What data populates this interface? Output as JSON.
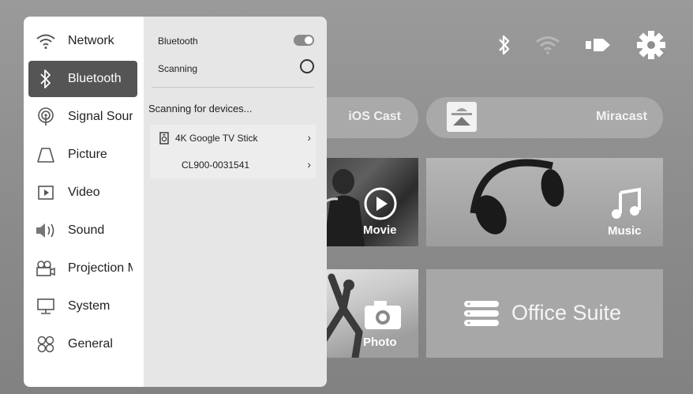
{
  "menu": {
    "items": [
      {
        "label": "Network",
        "icon": "wifi-icon"
      },
      {
        "label": "Bluetooth",
        "icon": "bluetooth-icon",
        "active": true
      },
      {
        "label": "Signal Source",
        "icon": "signal-source-icon"
      },
      {
        "label": "Picture",
        "icon": "picture-icon"
      },
      {
        "label": "Video",
        "icon": "video-icon"
      },
      {
        "label": "Sound",
        "icon": "speaker-icon"
      },
      {
        "label": "Projection Mode",
        "icon": "projector-icon"
      },
      {
        "label": "System",
        "icon": "monitor-icon"
      },
      {
        "label": "General",
        "icon": "general-icon"
      }
    ]
  },
  "panel": {
    "bluetooth_label": "Bluetooth",
    "bluetooth_on": true,
    "scanning_label": "Scanning",
    "scan_title": "Scanning for devices...",
    "devices": [
      {
        "name": "4K Google TV Stick",
        "icon": "speaker-device-icon",
        "chevron": "›"
      },
      {
        "name": "CL900-0031541",
        "chevron": "›"
      }
    ]
  },
  "tiles": {
    "ios_cast": "iOS Cast",
    "miracast": "Miracast",
    "movie": "Movie",
    "music": "Music",
    "photo": "Photo",
    "office": "Office Suite"
  },
  "status_icons": [
    "bluetooth-icon",
    "wifi-icon",
    "input-source-icon",
    "gear-icon"
  ],
  "colors": {
    "active_item": "#555555",
    "panel_bg": "#e6e6e6",
    "menu_bg": "#ffffff"
  }
}
